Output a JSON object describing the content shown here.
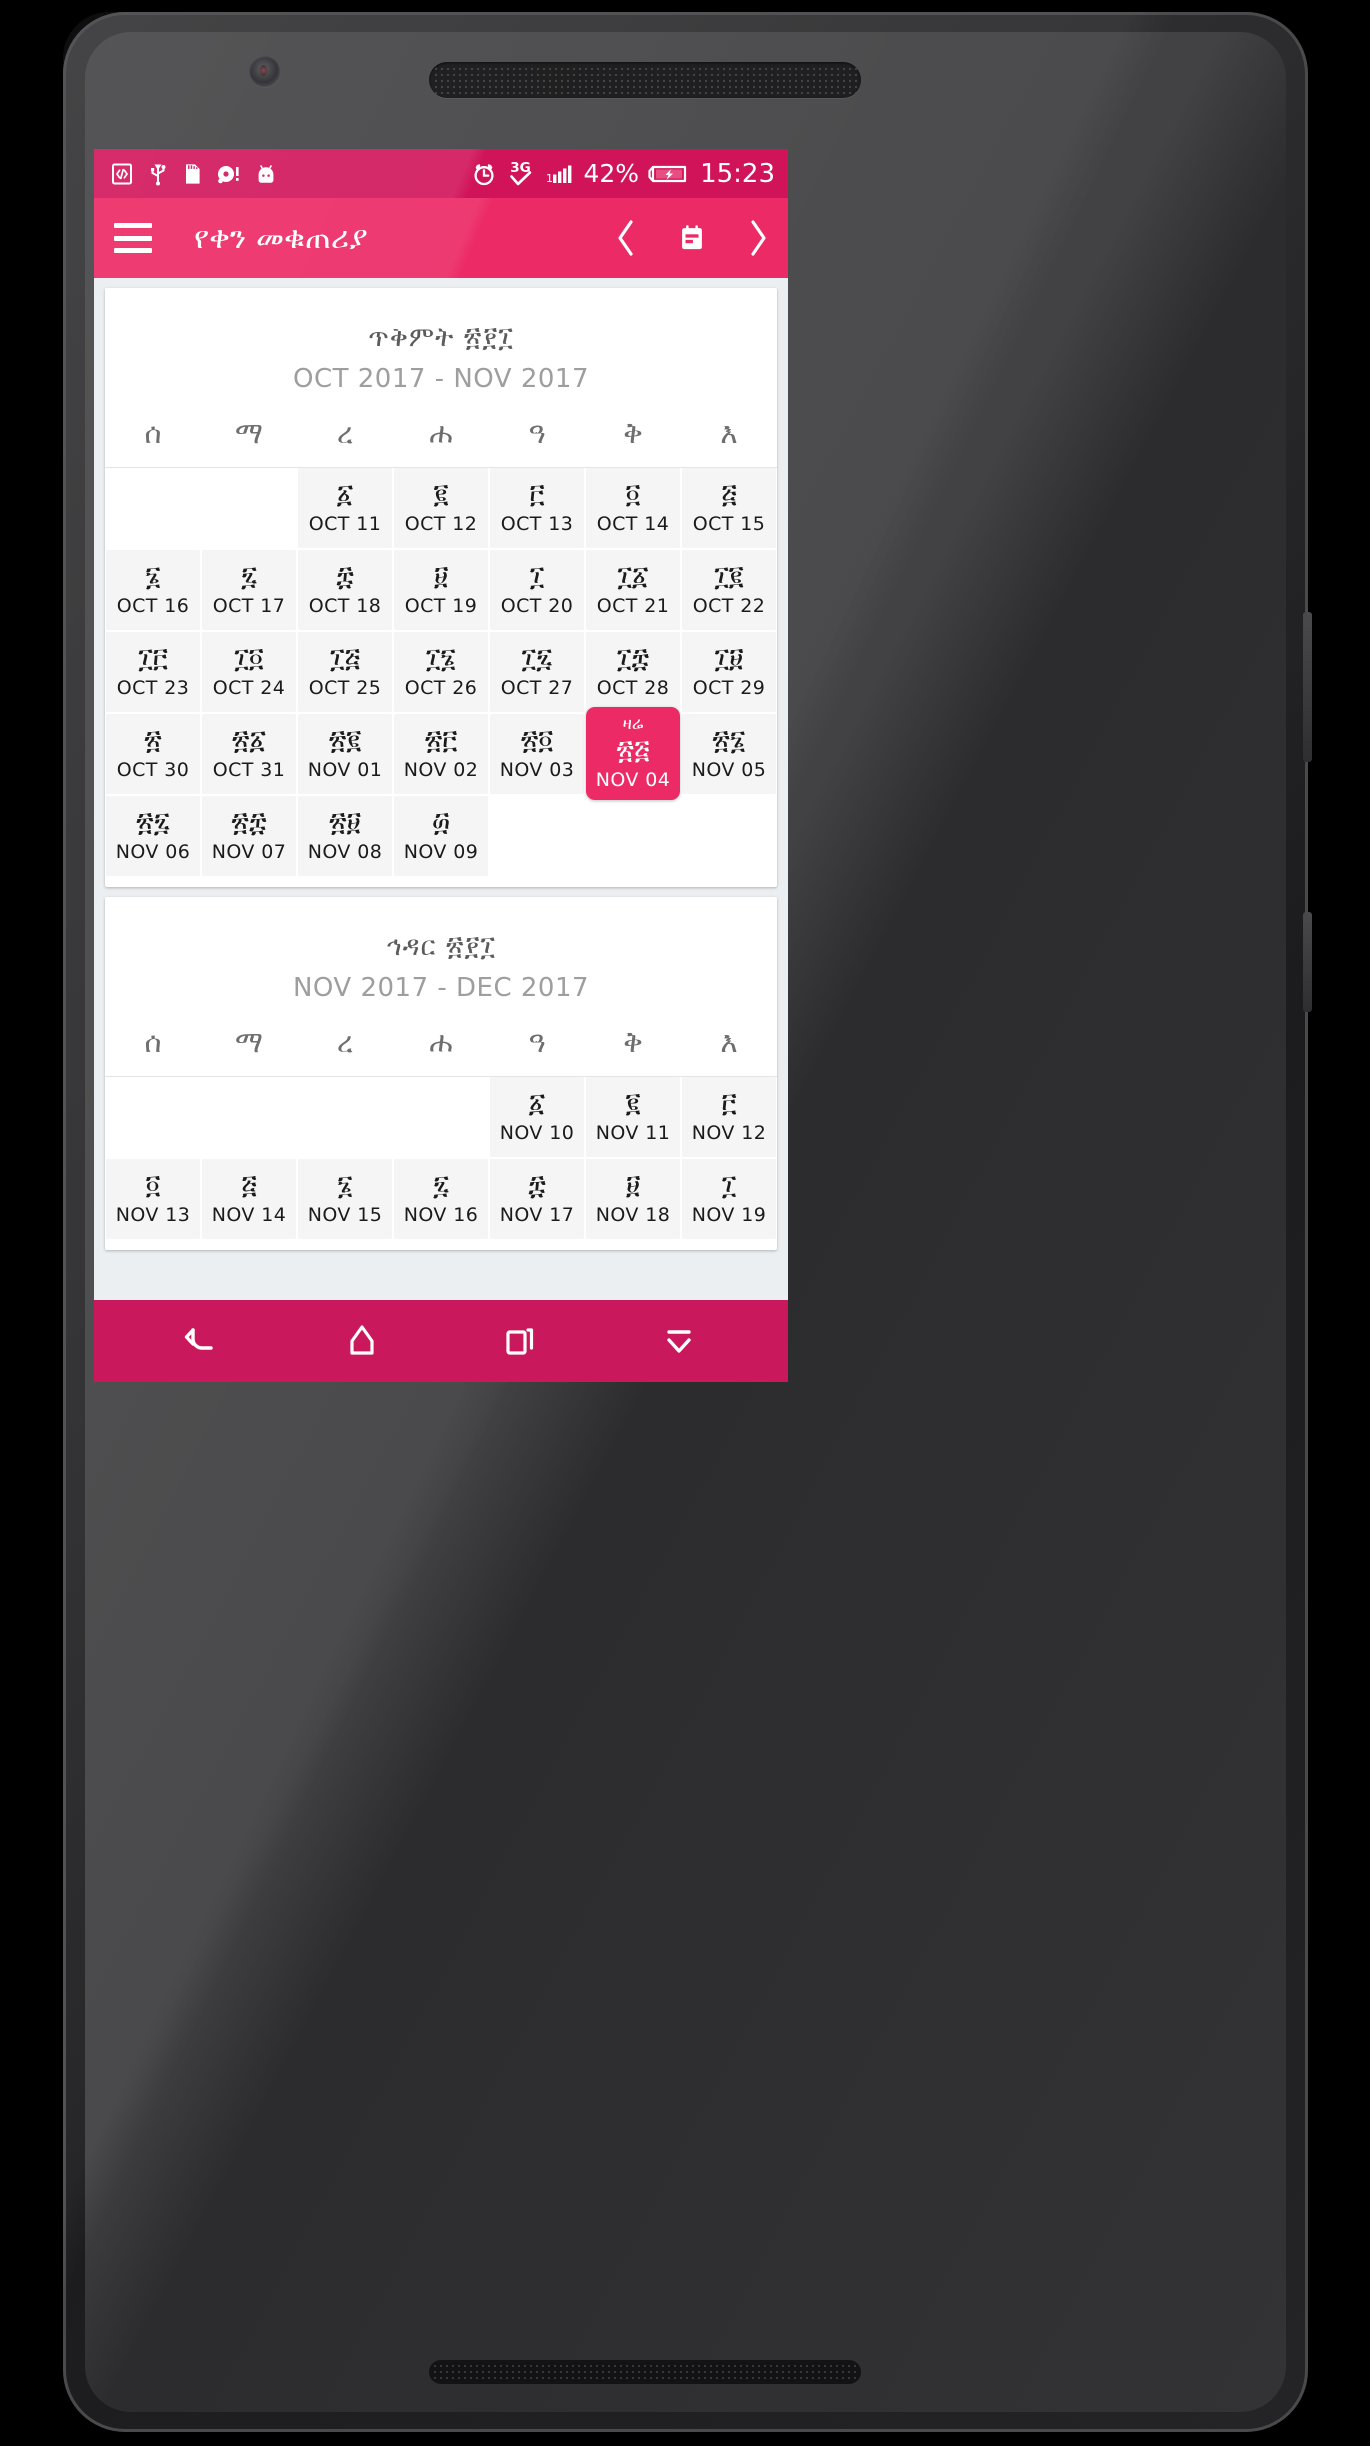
{
  "status_bar": {
    "background": "#d1145a",
    "left_icons": [
      {
        "name": "usb-debugging-icon",
        "glyph": "</>"
      },
      {
        "name": "usb-connection-icon",
        "glyph": "usb"
      },
      {
        "name": "sd-card-icon",
        "glyph": "sd"
      },
      {
        "name": "disc-alert-icon",
        "glyph": "disc"
      },
      {
        "name": "android-icon",
        "glyph": "android"
      }
    ],
    "right_icons": [
      {
        "name": "alarm-icon",
        "glyph": "alarm"
      },
      {
        "name": "network-3g-icon",
        "glyph": "3G"
      },
      {
        "name": "signal-bars-icon",
        "glyph": "signal"
      }
    ],
    "battery_percent": "42%",
    "battery_state": "charging",
    "clock": "15:23"
  },
  "app_bar": {
    "background": "#ec2a66",
    "menu_label": "menu",
    "title": "የቀን መቁጠሪያ",
    "prev_label": "‹",
    "calendar_label": "calendar",
    "next_label": "›"
  },
  "weekday_headers": [
    "ሰ",
    "ማ",
    "ረ",
    "ሐ",
    "ዓ",
    "ቅ",
    "እ"
  ],
  "today": {
    "label": "ዛሬ",
    "ethiopic": "፳፭",
    "gregorian": "NOV 04",
    "highlight_color": "#ec2a66"
  },
  "cards": [
    {
      "title": "ጥቅምት ፳፻፲",
      "subtitle": "OCT 2017 - NOV 2017",
      "weeks": [
        [
          {
            "empty": true
          },
          {
            "empty": true
          },
          {
            "eth": "፩",
            "greg": "OCT 11"
          },
          {
            "eth": "፪",
            "greg": "OCT 12"
          },
          {
            "eth": "፫",
            "greg": "OCT 13"
          },
          {
            "eth": "፬",
            "greg": "OCT 14"
          },
          {
            "eth": "፭",
            "greg": "OCT 15"
          }
        ],
        [
          {
            "eth": "፮",
            "greg": "OCT 16"
          },
          {
            "eth": "፯",
            "greg": "OCT 17"
          },
          {
            "eth": "፰",
            "greg": "OCT 18"
          },
          {
            "eth": "፱",
            "greg": "OCT 19"
          },
          {
            "eth": "፲",
            "greg": "OCT 20"
          },
          {
            "eth": "፲፩",
            "greg": "OCT 21"
          },
          {
            "eth": "፲፪",
            "greg": "OCT 22"
          }
        ],
        [
          {
            "eth": "፲፫",
            "greg": "OCT 23"
          },
          {
            "eth": "፲፬",
            "greg": "OCT 24"
          },
          {
            "eth": "፲፭",
            "greg": "OCT 25"
          },
          {
            "eth": "፲፮",
            "greg": "OCT 26"
          },
          {
            "eth": "፲፯",
            "greg": "OCT 27"
          },
          {
            "eth": "፲፰",
            "greg": "OCT 28"
          },
          {
            "eth": "፲፱",
            "greg": "OCT 29"
          }
        ],
        [
          {
            "eth": "፳",
            "greg": "OCT 30"
          },
          {
            "eth": "፳፩",
            "greg": "OCT 31"
          },
          {
            "eth": "፳፪",
            "greg": "NOV 01"
          },
          {
            "eth": "፳፫",
            "greg": "NOV 02"
          },
          {
            "eth": "፳፬",
            "greg": "NOV 03"
          },
          {
            "eth": "፳፭",
            "greg": "NOV 04",
            "today": true,
            "today_label": "ዛሬ"
          },
          {
            "eth": "፳፮",
            "greg": "NOV 05"
          }
        ],
        [
          {
            "eth": "፳፯",
            "greg": "NOV 06"
          },
          {
            "eth": "፳፰",
            "greg": "NOV 07"
          },
          {
            "eth": "፳፱",
            "greg": "NOV 08"
          },
          {
            "eth": "፴",
            "greg": "NOV 09"
          },
          {
            "empty": true
          },
          {
            "empty": true
          },
          {
            "empty": true
          }
        ]
      ]
    },
    {
      "title": "ኅዳር ፳፻፲",
      "subtitle": "NOV 2017 - DEC 2017",
      "weeks": [
        [
          {
            "empty": true
          },
          {
            "empty": true
          },
          {
            "empty": true
          },
          {
            "empty": true
          },
          {
            "eth": "፩",
            "greg": "NOV 10"
          },
          {
            "eth": "፪",
            "greg": "NOV 11"
          },
          {
            "eth": "፫",
            "greg": "NOV 12"
          }
        ],
        [
          {
            "eth": "፬",
            "greg": "NOV 13"
          },
          {
            "eth": "፭",
            "greg": "NOV 14"
          },
          {
            "eth": "፮",
            "greg": "NOV 15"
          },
          {
            "eth": "፯",
            "greg": "NOV 16"
          },
          {
            "eth": "፰",
            "greg": "NOV 17"
          },
          {
            "eth": "፱",
            "greg": "NOV 18"
          },
          {
            "eth": "፲",
            "greg": "NOV 19"
          }
        ]
      ]
    }
  ],
  "nav_bar": {
    "background": "#c9185b",
    "buttons": [
      {
        "name": "back-button",
        "label": "back"
      },
      {
        "name": "home-button",
        "label": "home"
      },
      {
        "name": "recents-button",
        "label": "recents"
      },
      {
        "name": "hide-keyboard-button",
        "label": "hide"
      }
    ]
  }
}
